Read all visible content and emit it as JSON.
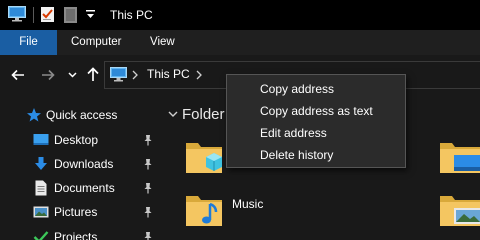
{
  "window": {
    "title": "This PC"
  },
  "quick_access_toolbar": {
    "icons": [
      "this-pc-icon",
      "properties-icon",
      "new-folder-icon",
      "customize-dropdown-icon"
    ]
  },
  "ribbon": {
    "tabs": [
      {
        "label": "File",
        "active": true
      },
      {
        "label": "Computer",
        "active": false
      },
      {
        "label": "View",
        "active": false
      }
    ],
    "accent_color": "#1a5ea3"
  },
  "address_bar": {
    "path": "This PC"
  },
  "nav_pane": {
    "items": [
      {
        "label": "Quick access",
        "icon": "star-icon",
        "pinned": false
      },
      {
        "label": "Desktop",
        "icon": "desktop-icon",
        "pinned": true
      },
      {
        "label": "Downloads",
        "icon": "download-icon",
        "pinned": true
      },
      {
        "label": "Documents",
        "icon": "document-icon",
        "pinned": true
      },
      {
        "label": "Pictures",
        "icon": "pictures-icon",
        "pinned": true
      },
      {
        "label": "Projects",
        "icon": "check-icon",
        "pinned": true
      }
    ]
  },
  "content": {
    "group_title": "Folder",
    "folders": [
      {
        "label": "",
        "icon": "3d-objects-folder-icon"
      },
      {
        "label": "",
        "icon": "desktop-folder-icon"
      },
      {
        "label": "Music",
        "icon": "music-folder-icon"
      },
      {
        "label": "",
        "icon": "pictures-folder-icon"
      }
    ]
  },
  "context_menu": {
    "items": [
      {
        "label": "Copy address"
      },
      {
        "label": "Copy address as text"
      },
      {
        "label": "Edit address"
      },
      {
        "label": "Delete history"
      }
    ]
  }
}
